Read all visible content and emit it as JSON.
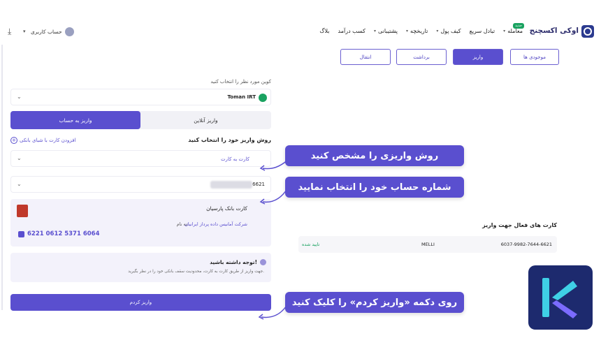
{
  "header": {
    "brand": "اوکی اکسچنج",
    "nav": [
      {
        "label": "معامله",
        "badge": "جدید"
      },
      {
        "label": "تبادل سریع",
        "badge": ""
      },
      {
        "label": "کیف پول",
        "badge": ""
      },
      {
        "label": "تاریخچه",
        "badge": ""
      },
      {
        "label": "پشتیبانی",
        "badge": ""
      },
      {
        "label": "کسب درآمد",
        "badge": ""
      },
      {
        "label": "بلاگ",
        "badge": ""
      }
    ],
    "user_label": "حساب کاربری"
  },
  "tabs": {
    "balances": "موجودی ها",
    "deposit": "واریز",
    "withdraw": "برداشت",
    "transfer": "انتقال"
  },
  "form": {
    "coin_prompt": "کوین مورد نظر را انتخاب کنید",
    "coin_value": "Toman IRT",
    "method_tab_account": "واریز به حساب",
    "method_tab_online": "واریز آنلاین",
    "method_prompt": "روش واریز خود را انتخاب کنید",
    "add_card": "افزودن کارت با شبای بانکی",
    "method_value": "کارت به کارت",
    "account_prefix": "6621",
    "bank_title": "کارت بانک پارسیان",
    "owner_prefix": "به نام:",
    "owner_name": "شرکت آمانیس داده پرداز ایرانیان",
    "card_number": "6221 0612 5371 6064",
    "notice_title": "توجه داشته باشید!",
    "notice_text": "جهت واریز از طریق کارت به کارت، محدودیت سقف بانکی خود را در نظر بگیرید.",
    "submit": "واریز کردم"
  },
  "callouts": {
    "c1": "روش واریزی را مشخص کنید",
    "c2": "شماره حساب خود را انتخاب نمایید",
    "c3": "روی دکمه «واریز کردم» را کلیک کنید"
  },
  "active_cards": {
    "title": "کارت های فعال جهت واریز",
    "rows": [
      {
        "number": "6037-9982-7644-6621",
        "bank": "MELLI",
        "status": "تایید شده"
      }
    ]
  },
  "colors": {
    "accent": "#5a4fcf",
    "success": "#1aa260"
  }
}
